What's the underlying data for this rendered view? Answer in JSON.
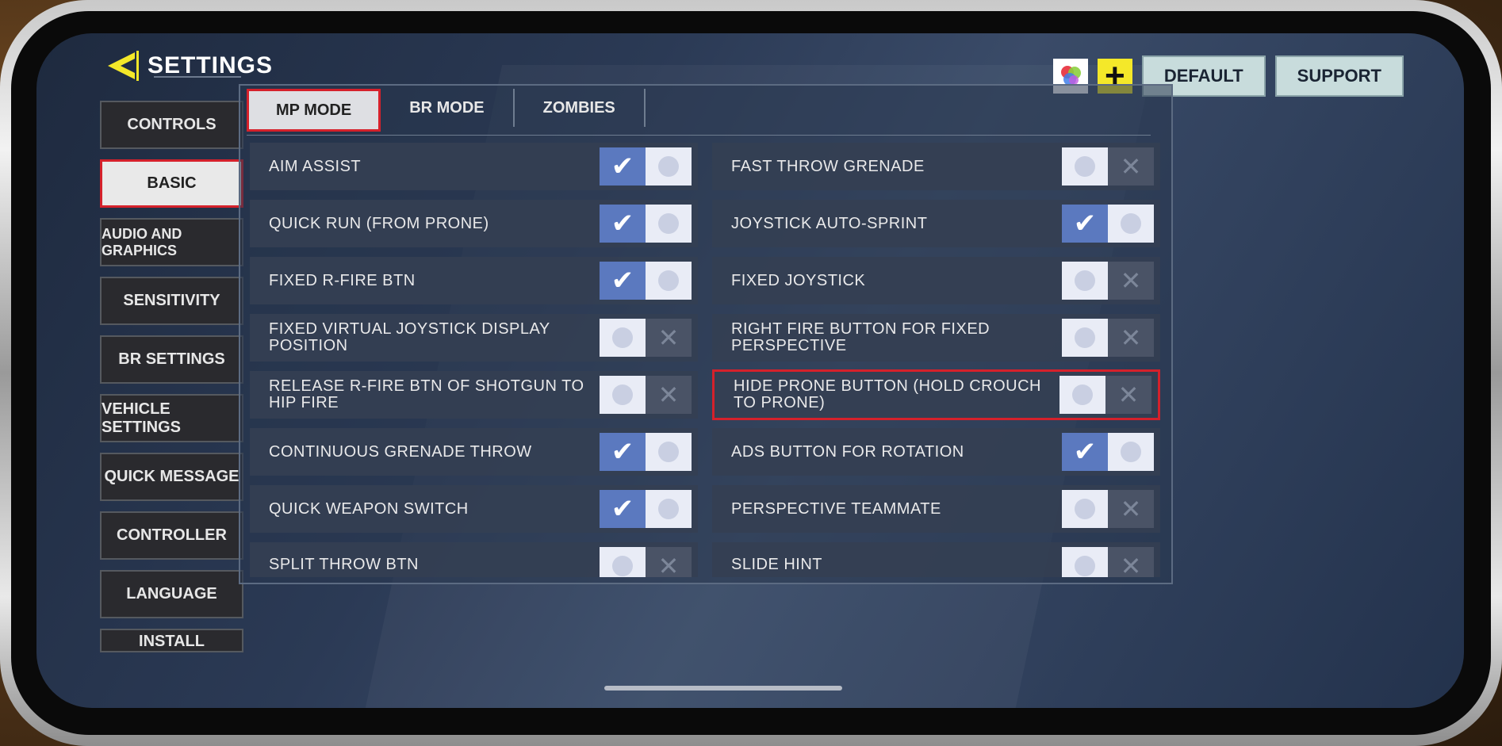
{
  "header": {
    "title": "SETTINGS"
  },
  "top_buttons": {
    "default_label": "DEFAULT",
    "support_label": "SUPPORT",
    "plus_label": "+"
  },
  "sidebar": {
    "items": [
      {
        "label": "CONTROLS",
        "active": false
      },
      {
        "label": "BASIC",
        "active": true
      },
      {
        "label": "AUDIO AND GRAPHICS",
        "active": false
      },
      {
        "label": "SENSITIVITY",
        "active": false
      },
      {
        "label": "BR SETTINGS",
        "active": false
      },
      {
        "label": "VEHICLE SETTINGS",
        "active": false
      },
      {
        "label": "QUICK MESSAGE",
        "active": false
      },
      {
        "label": "CONTROLLER",
        "active": false
      },
      {
        "label": "LANGUAGE",
        "active": false
      },
      {
        "label": "INSTALL",
        "active": false
      }
    ]
  },
  "tabs": [
    {
      "label": "MP MODE",
      "active": true
    },
    {
      "label": "BR MODE",
      "active": false
    },
    {
      "label": "ZOMBIES",
      "active": false
    }
  ],
  "settings_left": [
    {
      "label": "AIM ASSIST",
      "on": true
    },
    {
      "label": "QUICK RUN (FROM PRONE)",
      "on": true
    },
    {
      "label": "FIXED R-FIRE BTN",
      "on": true
    },
    {
      "label": "FIXED VIRTUAL JOYSTICK DISPLAY POSITION",
      "on": false
    },
    {
      "label": "RELEASE R-FIRE BTN OF SHOTGUN TO HIP FIRE",
      "on": false
    },
    {
      "label": "CONTINUOUS GRENADE THROW",
      "on": true
    },
    {
      "label": "QUICK WEAPON SWITCH",
      "on": true
    },
    {
      "label": "SPLIT THROW BTN",
      "on": false
    }
  ],
  "settings_right": [
    {
      "label": "FAST THROW GRENADE",
      "on": false
    },
    {
      "label": "JOYSTICK AUTO-SPRINT",
      "on": true
    },
    {
      "label": "FIXED JOYSTICK",
      "on": false
    },
    {
      "label": "RIGHT FIRE BUTTON FOR FIXED PERSPECTIVE",
      "on": false
    },
    {
      "label": "HIDE PRONE BUTTON (HOLD CROUCH TO PRONE)",
      "on": false,
      "highlighted": true
    },
    {
      "label": "ADS BUTTON FOR ROTATION",
      "on": true
    },
    {
      "label": "PERSPECTIVE TEAMMATE",
      "on": false
    },
    {
      "label": "SLIDE HINT",
      "on": false
    }
  ],
  "colors": {
    "accent": "#f4e829",
    "highlight": "#d5212b",
    "toggle_on": "#5b79bf"
  },
  "icons": {
    "check": "check-icon",
    "cross": "close-icon"
  }
}
